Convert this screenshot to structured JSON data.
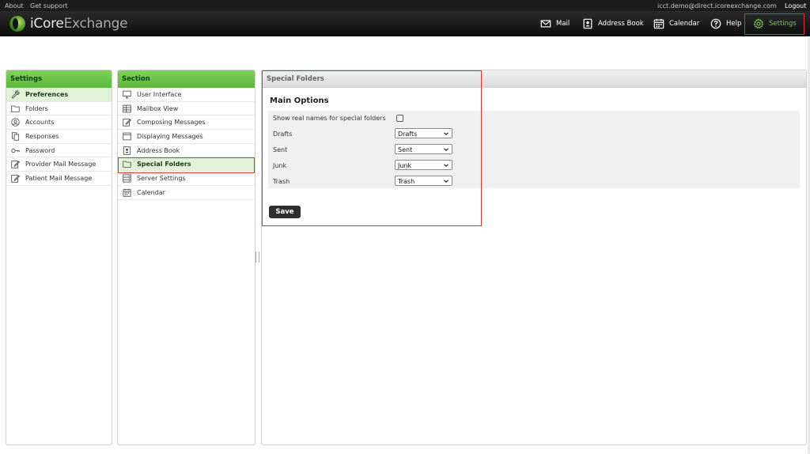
{
  "topbar": {
    "about": "About",
    "support": "Get support",
    "email": "icct.demo@direct.icoreexchange.com",
    "logout": "Logout"
  },
  "logo": {
    "part1": "iCore",
    "part2": "Exchange"
  },
  "nav": {
    "mail": "Mail",
    "address_book": "Address Book",
    "calendar": "Calendar",
    "help": "Help",
    "settings": "Settings"
  },
  "settings_panel": {
    "title": "Settings",
    "items": [
      {
        "label": "Preferences",
        "icon": "wrench-icon"
      },
      {
        "label": "Folders",
        "icon": "folder-icon"
      },
      {
        "label": "Accounts",
        "icon": "user-circle-icon"
      },
      {
        "label": "Responses",
        "icon": "documents-icon"
      },
      {
        "label": "Password",
        "icon": "key-icon"
      },
      {
        "label": "Provider Mail Message",
        "icon": "edit-icon"
      },
      {
        "label": "Patient Mail Message",
        "icon": "edit-icon"
      }
    ]
  },
  "section_panel": {
    "title": "Section",
    "items": [
      {
        "label": "User Interface",
        "icon": "monitor-icon"
      },
      {
        "label": "Mailbox View",
        "icon": "grid-icon"
      },
      {
        "label": "Composing Messages",
        "icon": "edit-icon"
      },
      {
        "label": "Displaying Messages",
        "icon": "window-icon"
      },
      {
        "label": "Address Book",
        "icon": "contact-icon"
      },
      {
        "label": "Special Folders",
        "icon": "folder-icon"
      },
      {
        "label": "Server Settings",
        "icon": "server-icon"
      },
      {
        "label": "Calendar",
        "icon": "calendar-icon"
      }
    ]
  },
  "main": {
    "header": "Special Folders",
    "title": "Main Options",
    "show_real_names_label": "Show real names for special folders",
    "show_real_names_checked": false,
    "rows": [
      {
        "label": "Drafts",
        "value": "Drafts"
      },
      {
        "label": "Sent",
        "value": "Sent"
      },
      {
        "label": "Junk",
        "value": "Junk"
      },
      {
        "label": "Trash",
        "value": "Trash"
      }
    ],
    "save_label": "Save"
  },
  "colors": {
    "accent_green": "#5cb83b",
    "highlight_red": "#e0332b",
    "header_dark": "#0d0d0d"
  }
}
